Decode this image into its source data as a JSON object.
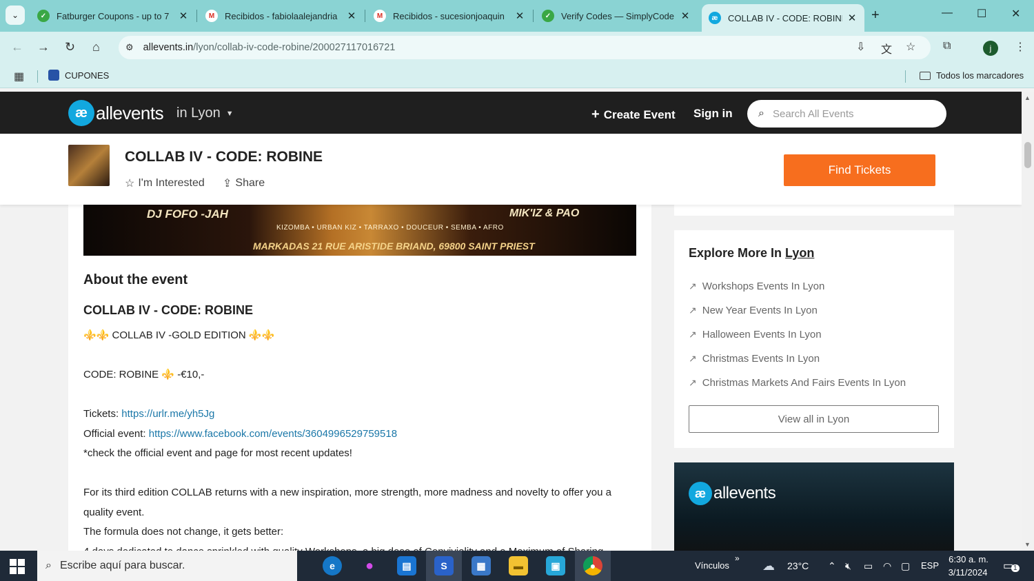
{
  "browser": {
    "tabs": [
      {
        "title": "Fatburger Coupons - up to 7",
        "icon": "coupon-check-icon",
        "color": "#3aa745"
      },
      {
        "title": "Recibidos - fabiolaalejandria",
        "icon": "gmail-icon",
        "color": "#d93025"
      },
      {
        "title": "Recibidos - sucesionjoaquin",
        "icon": "gmail-icon",
        "color": "#d93025"
      },
      {
        "title": "Verify Codes — SimplyCode",
        "icon": "coupon-check-icon",
        "color": "#3aa745"
      },
      {
        "title": "COLLAB IV - CODE: ROBINE",
        "icon": "allevents-icon",
        "color": "#12a8df"
      }
    ],
    "url_host": "allevents.in",
    "url_path": "/lyon/collab-iv-code-robine/200027117016721",
    "bookmark": "CUPONES",
    "all_bookmarks": "Todos los marcadores",
    "profile_initial": "j"
  },
  "site": {
    "logo_mark": "æ",
    "logo_text": "allevents",
    "city_prefix": "in",
    "city": "Lyon",
    "create_event": "Create Event",
    "sign_in": "Sign in",
    "search_placeholder": "Search All Events"
  },
  "event": {
    "title": "COLLAB IV - CODE: ROBINE",
    "interested": "I'm Interested",
    "share": "Share",
    "find_tickets": "Find Tickets",
    "banner_left": "DJ FOFO -JAH",
    "banner_right": "MIK'IZ & PAO",
    "banner_tags": "KIZOMBA • URBAN KIZ • TARRAXO • DOUCEUR • SEMBA • AFRO",
    "banner_venue": "MARKADAS 21 RUE ARISTIDE BRIAND, 69800 SAINT PRIEST"
  },
  "about": {
    "heading": "About the event",
    "title": "COLLAB IV - CODE: ROBINE",
    "gold_line": "⚜️⚜️ COLLAB IV -GOLD EDITION ⚜️⚜️",
    "code_line": "CODE: ROBINE ⚜️ -€10,-",
    "tickets_label": "Tickets: ",
    "tickets_link": "https://urlr.me/yh5Jg",
    "official_label": "Official event: ",
    "official_link": "https://www.facebook.com/events/3604996529759518",
    "check_line": "*check the official event and page for most recent updates!",
    "para1": "For its third edition COLLAB returns with a new inspiration, more strength, more madness and novelty to offer you a quality event.",
    "para2": "The formula does not change, it gets better:",
    "para3": "4 days dedicated to dance sprinkled with quality Workshops, a big dose of Conviviality and a Maximum of Sharing."
  },
  "explore": {
    "heading_prefix": "Explore More In ",
    "heading_city": "Lyon",
    "items": [
      "Workshops Events In Lyon",
      "New Year Events In Lyon",
      "Halloween Events In Lyon",
      "Christmas Events In Lyon",
      "Christmas Markets And Fairs Events In Lyon"
    ],
    "view_all": "View all in Lyon"
  },
  "promo": {
    "logo_text": "allevents"
  },
  "taskbar": {
    "search_placeholder": "Escribe aquí para buscar.",
    "vinculos": "Vínculos",
    "weather": "23°C",
    "lang": "ESP",
    "time": "6:30 a. m.",
    "date": "3/11/2024",
    "notifications": "1"
  },
  "colors": {
    "accent_orange": "#f76e1e",
    "brand_blue": "#12a8df",
    "header_dark": "#1f1f1f",
    "link_blue": "#1a77a8",
    "chrome_teal": "#8ad3d3"
  }
}
